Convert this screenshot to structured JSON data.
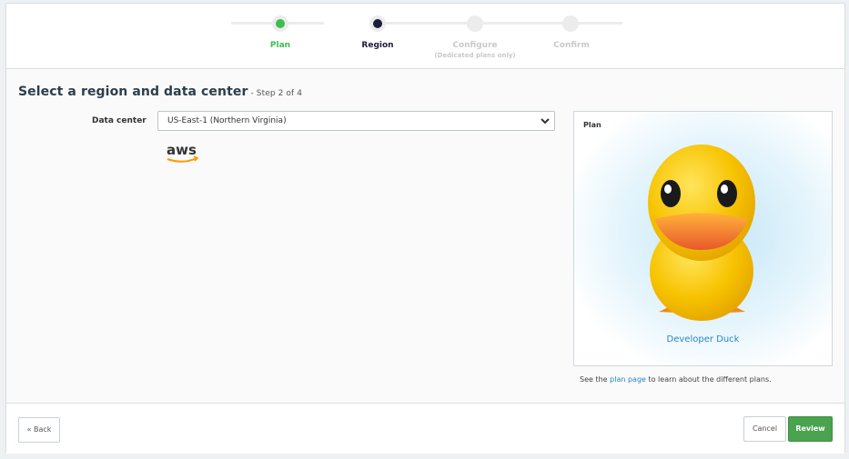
{
  "wizard": {
    "steps": [
      {
        "label": "Plan",
        "sub": "",
        "state": "done",
        "color": "#3dbd52"
      },
      {
        "label": "Region",
        "sub": "",
        "state": "current",
        "color": "#1b1c3a"
      },
      {
        "label": "Configure",
        "sub": "(Dedicated plans only)",
        "state": "pending",
        "color": "#c9c9c9"
      },
      {
        "label": "Confirm",
        "sub": "",
        "state": "pending",
        "color": "#c9c9c9"
      }
    ]
  },
  "main": {
    "title": "Select a region and data center",
    "step_text": "- Step 2 of 4",
    "data_center_label": "Data center",
    "data_center_value": "US-East-1 (Northern Virginia)",
    "provider_logo": "aws"
  },
  "plan_card": {
    "title": "Plan",
    "plan_name": "Developer Duck"
  },
  "plan_note": {
    "before": "See the ",
    "link": "plan page",
    "after": " to learn about the different plans."
  },
  "footer": {
    "back_label": "« Back",
    "cancel_label": "Cancel",
    "review_label": "Review"
  },
  "colors": {
    "accent_green": "#4ba24f",
    "link_blue": "#2a86c3",
    "aws_orange": "#f90"
  }
}
